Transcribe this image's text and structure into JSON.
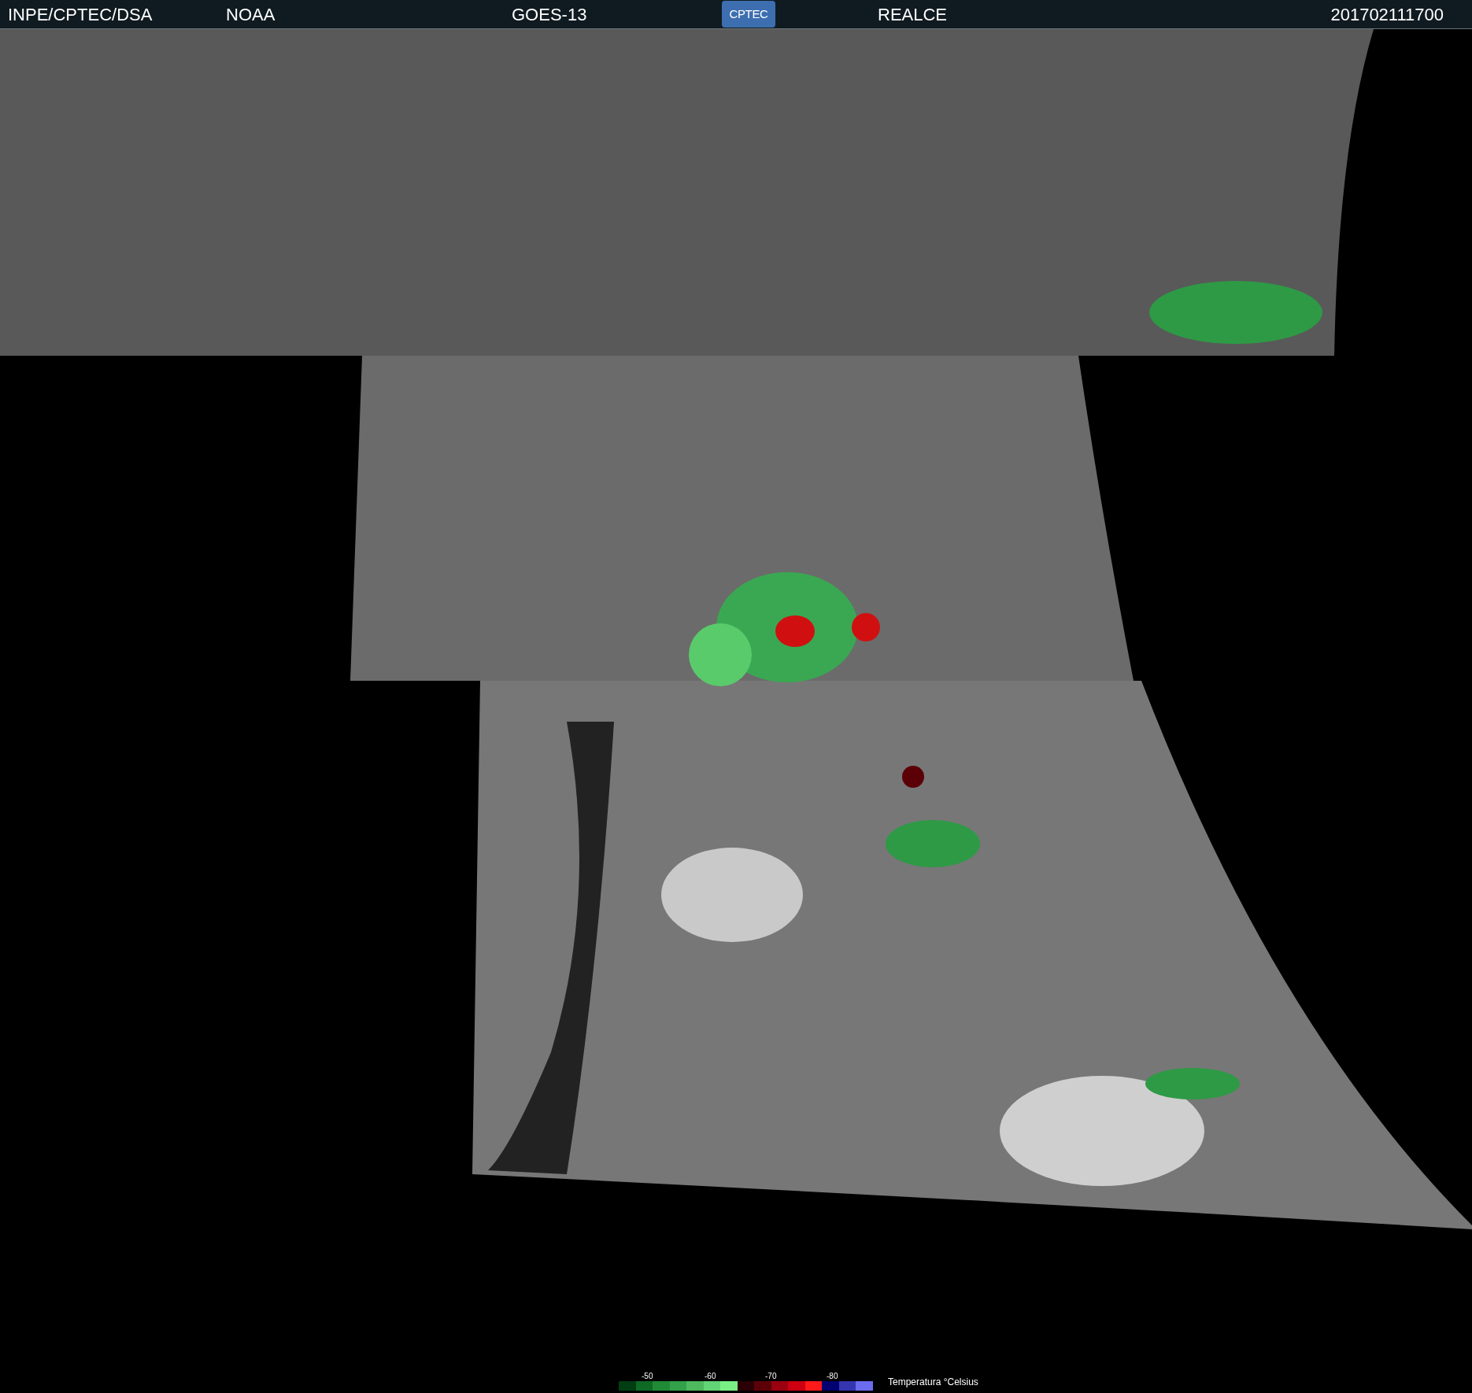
{
  "header": {
    "agency": "INPE/CPTEC/DSA",
    "source": "NOAA",
    "satellite": "GOES-13",
    "logo": "CPTEC",
    "product": "REALCE",
    "timestamp": "201702111700"
  },
  "legend": {
    "title": "Temperatura °Celsius",
    "ticks": [
      "-50",
      "-60",
      "-70",
      "-80"
    ],
    "swatches": [
      {
        "color": "#003d12"
      },
      {
        "color": "#0e6a24"
      },
      {
        "color": "#218a37"
      },
      {
        "color": "#33a04a"
      },
      {
        "color": "#4db85e"
      },
      {
        "color": "#63d475"
      },
      {
        "color": "#7aef85"
      },
      {
        "color": "#2a0005"
      },
      {
        "color": "#5c0008"
      },
      {
        "color": "#9a0010"
      },
      {
        "color": "#cc0010"
      },
      {
        "color": "#ff1a1a"
      },
      {
        "color": "#000070"
      },
      {
        "color": "#3535b0"
      },
      {
        "color": "#6b6bf0"
      }
    ]
  }
}
